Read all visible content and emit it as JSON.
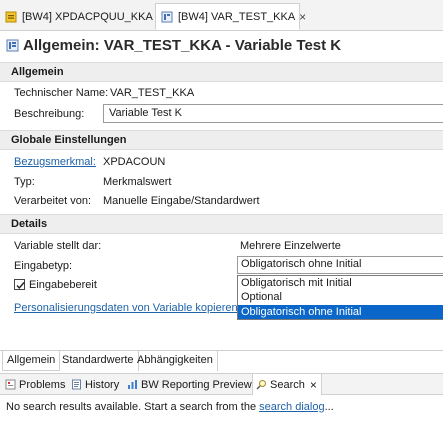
{
  "editor_tabs": [
    {
      "label": "[BW4] XPDACPQUU_KKA"
    },
    {
      "label": "[BW4] VAR_TEST_KKA",
      "close": "×"
    }
  ],
  "header": {
    "title": "Allgemein: VAR_TEST_KKA - Variable Test K"
  },
  "allgemein": {
    "section_title": "Allgemein",
    "tech_name_label": "Technischer Name:",
    "tech_name_value": "VAR_TEST_KKA",
    "desc_label": "Beschreibung:",
    "desc_value": "Variable Test K"
  },
  "globale": {
    "section_title": "Globale Einstellungen",
    "bezugsmerkmal_label": "Bezugsmerkmal:",
    "bezugsmerkmal_value": "XPDACOUN",
    "typ_label": "Typ:",
    "typ_value": "Merkmalswert",
    "verarbeitet_label": "Verarbeitet von:",
    "verarbeitet_value": "Manuelle Eingabe/Standardwert"
  },
  "details": {
    "section_title": "Details",
    "stellt_dar_label": "Variable stellt dar:",
    "stellt_dar_value": "Mehrere Einzelwerte",
    "eingabetyp_label": "Eingabetyp:",
    "eingabetyp_value": "Obligatorisch ohne Initial",
    "eingabebereit_label": "Eingabebereit",
    "eingabebereit_checked": true,
    "personalisierung_link": "Personalisierungsdaten von Variable kopieren:",
    "dropdown_options": [
      "Obligatorisch mit Initial",
      "Optional",
      "Obligatorisch ohne Initial"
    ],
    "dropdown_selected_index": 2
  },
  "page_tabs": [
    "Allgemein",
    "Standardwerte",
    "Abhängigkeiten"
  ],
  "views": [
    {
      "label": "Problems",
      "icon": "problems-icon"
    },
    {
      "label": "History",
      "icon": "history-icon"
    },
    {
      "label": "BW Reporting Preview",
      "icon": "bw-reporting-preview-icon"
    },
    {
      "label": "Search",
      "icon": "search-icon",
      "close": "×"
    }
  ],
  "search_view": {
    "message": "No search results available. Start a search from the ",
    "link": "search dialog",
    "suffix": "..."
  },
  "colors": {
    "link": "#1e62a8",
    "selection": "#0a66c9"
  }
}
